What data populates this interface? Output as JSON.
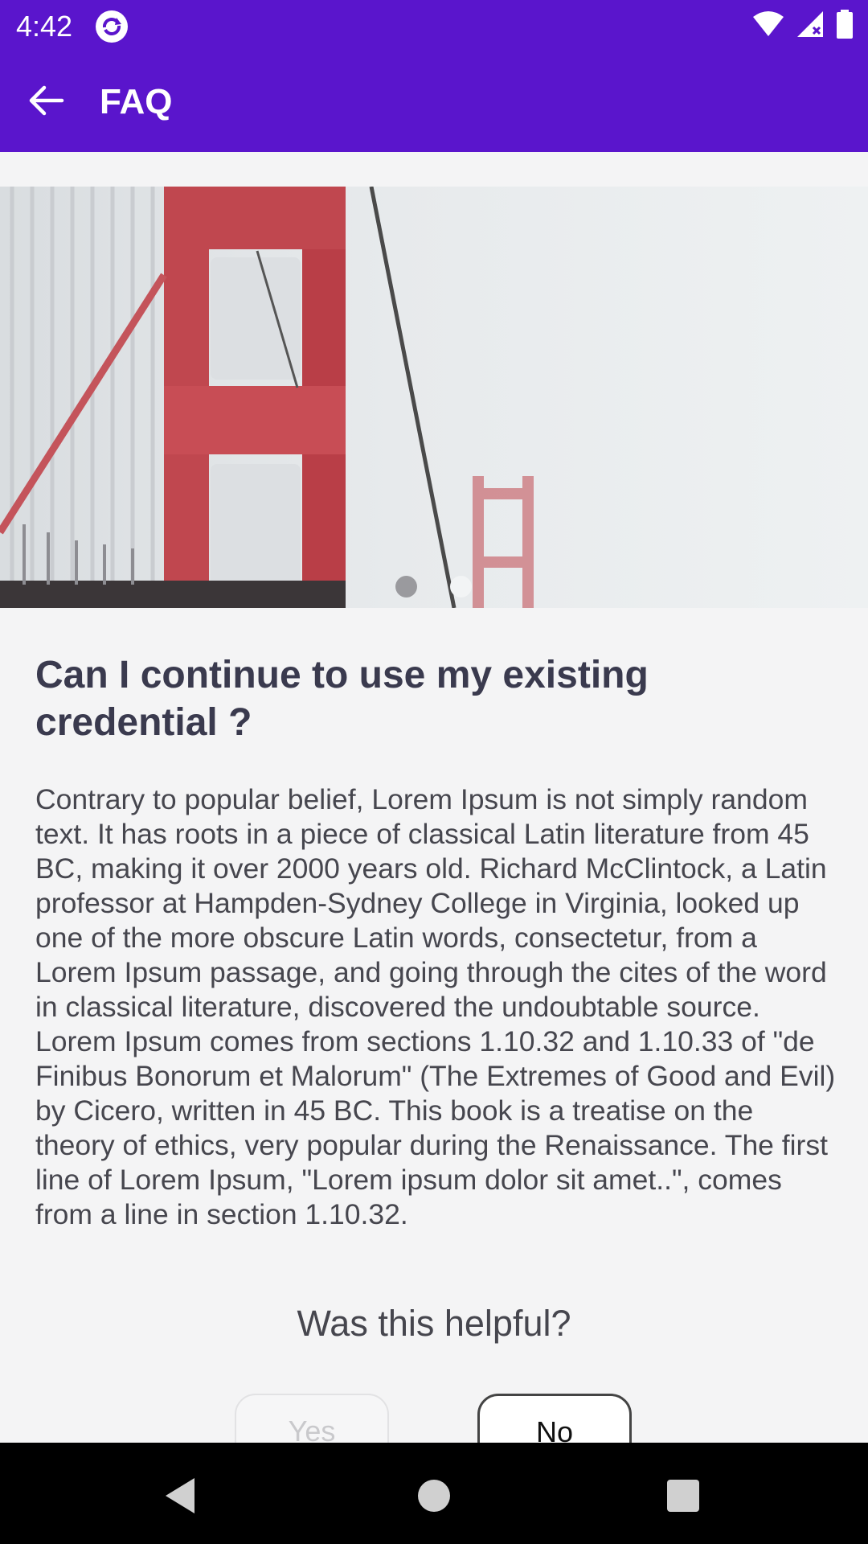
{
  "status_bar": {
    "time": "4:42"
  },
  "app_bar": {
    "title": "FAQ"
  },
  "carousel": {
    "page_count": 2,
    "active_index": 0
  },
  "faq": {
    "question": "Can I continue to use my existing credential ?",
    "answer": "Contrary to popular belief, Lorem Ipsum is not simply random text. It has roots in a piece of classical Latin literature from 45 BC, making it over 2000 years old. Richard McClintock, a Latin professor at Hampden-Sydney College in Virginia, looked up one of the more obscure Latin words, consectetur, from a Lorem Ipsum passage, and going through the cites of the word in classical literature, discovered the undoubtable source. Lorem Ipsum comes from sections 1.10.32 and 1.10.33 of \"de Finibus Bonorum et Malorum\" (The Extremes of Good and Evil) by Cicero, written in 45 BC. This book is a treatise on the theory of ethics, very popular during the Renaissance. The first line of Lorem Ipsum, \"Lorem ipsum dolor sit amet..\", comes from a line in section 1.10.32."
  },
  "feedback": {
    "prompt": "Was this helpful?",
    "yes_label": "Yes",
    "no_label": "No"
  },
  "colors": {
    "primary": "#5a15cc",
    "background": "#f4f4f5",
    "question_text": "#3a3a4e",
    "body_text": "#46464e"
  },
  "icons": [
    "refresh-app-icon",
    "wifi-icon",
    "signal-icon",
    "battery-icon",
    "back-arrow-icon",
    "nav-back-icon",
    "nav-home-icon",
    "nav-recents-icon"
  ]
}
